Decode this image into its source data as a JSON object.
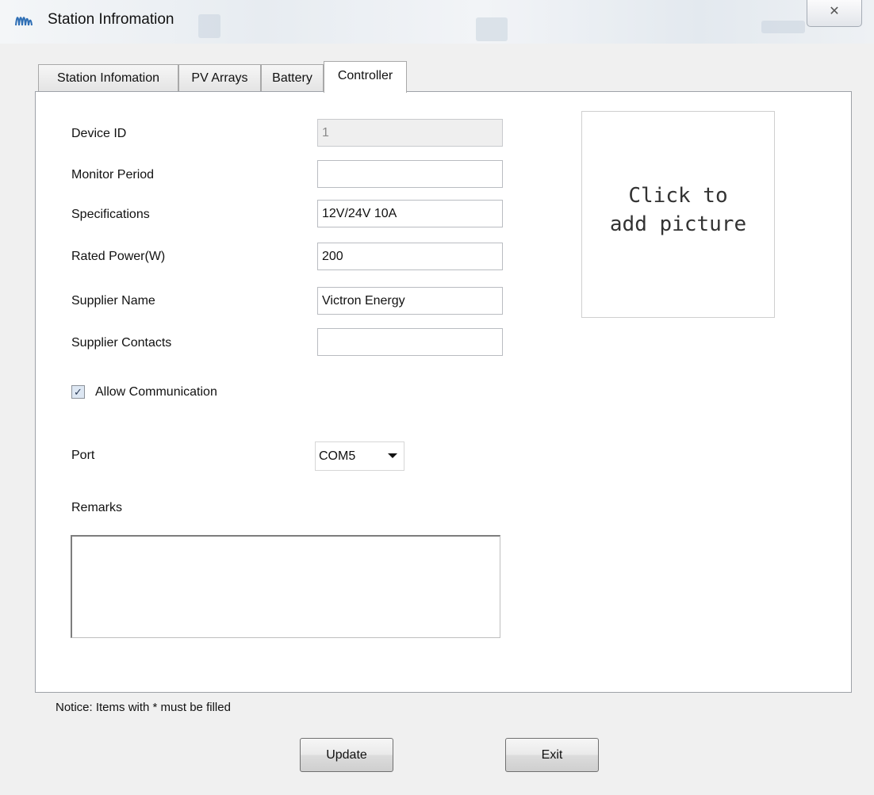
{
  "window": {
    "title": "Station Infromation",
    "close_glyph": "✕"
  },
  "tabs": [
    {
      "label": "Station Infomation",
      "active": false
    },
    {
      "label": "PV Arrays",
      "active": false
    },
    {
      "label": "Battery",
      "active": false
    },
    {
      "label": "Controller",
      "active": true
    }
  ],
  "form": {
    "device_id": {
      "label": "Device ID",
      "value": "1",
      "disabled": true
    },
    "monitor_period": {
      "label": "Monitor Period",
      "value": ""
    },
    "specifications": {
      "label": "Specifications",
      "value": "12V/24V 10A"
    },
    "rated_power": {
      "label": "Rated Power(W)",
      "value": "200"
    },
    "supplier_name": {
      "label": "Supplier Name",
      "value": "Victron Energy"
    },
    "supplier_contacts": {
      "label": "Supplier Contacts",
      "value": ""
    },
    "allow_communication": {
      "label": "Allow Communication",
      "checked": true,
      "check_glyph": "✓"
    },
    "port": {
      "label": "Port",
      "value": "COM5"
    },
    "remarks": {
      "label": "Remarks",
      "value": ""
    }
  },
  "picture": {
    "line1": "Click to",
    "line2": "add picture"
  },
  "notice": "Notice: Items with * must be filled",
  "buttons": {
    "update": "Update",
    "exit": "Exit"
  },
  "colors": {
    "icon_blue": "#2f6fb5",
    "panel_bg": "#ffffff",
    "window_bg": "#f0f0f0"
  }
}
